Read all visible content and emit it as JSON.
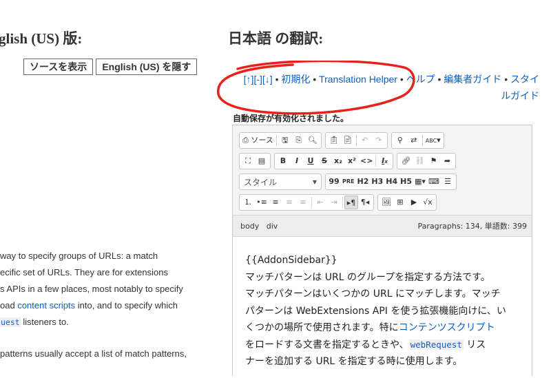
{
  "headings": {
    "left": "glish (US) 版:",
    "right": "日本語 の翻訳:"
  },
  "buttons": {
    "view_source": "ソースを表示",
    "hide_english": "English (US) を隠す"
  },
  "nav": {
    "up": "[↑]",
    "collapse": "[-]",
    "down": "[↓]",
    "sep": " • ",
    "reset": "初期化",
    "translation_helper": "Translation Helper",
    "help": "ヘルプ",
    "editor_guide": "編集者ガイド",
    "style_guide": "スタイルガイド"
  },
  "autosave_notice": "自動保存が有効化されました。",
  "toolbar": {
    "source_label": "ソース",
    "style_combo": "スタイル",
    "quote": "99",
    "pre": "PRE",
    "h2": "H2",
    "h3": "H3",
    "h4": "H4",
    "h5": "H5",
    "bold": "B",
    "italic": "I",
    "underline": "U",
    "strike": "S",
    "subscript": "x₂",
    "superscript": "x²",
    "code": "<>",
    "remove_format": "Ix",
    "math": "√x",
    "spellcheck": "ABC"
  },
  "pathbar": {
    "path": [
      "body",
      "div"
    ],
    "stats": "Paragraphs: 134, 単語数: 399"
  },
  "content": {
    "macro": "{{AddonSidebar}}",
    "line1": "マッチパターンは URL のグループを指定する方法です。",
    "line2": "マッチパターンはいくつかの URL にマッチします。マッチ",
    "line3": "パターンは WebExtensions API を使う拡張機能向けに、い",
    "line4_pre": "くつかの場所で使用されます。特に",
    "line4_link": "コンテンツスクリプト",
    "line5_pre": "をロードする文書を指定するときや、",
    "line5_code": "webRequest",
    "line5_post": " リス",
    "line6": "ナーを追加する URL を指定する時に使用します。"
  },
  "english": {
    "l1": "way to specify groups of URLs: a match",
    "l2": "ecific set of URLs. They are for extensions",
    "l3": "s APIs in a few places, most notably to specify",
    "l4_pre": "oad ",
    "l4_link": "content scripts",
    "l4_post": " into, and to specify which",
    "l5_code": "uest",
    "l5_post": " listeners to.",
    "l6": "patterns usually accept a list of match patterns,"
  },
  "colors": {
    "link": "#0b5ec6",
    "annotation": "#e8221b",
    "code_bg": "#eef0f2"
  }
}
